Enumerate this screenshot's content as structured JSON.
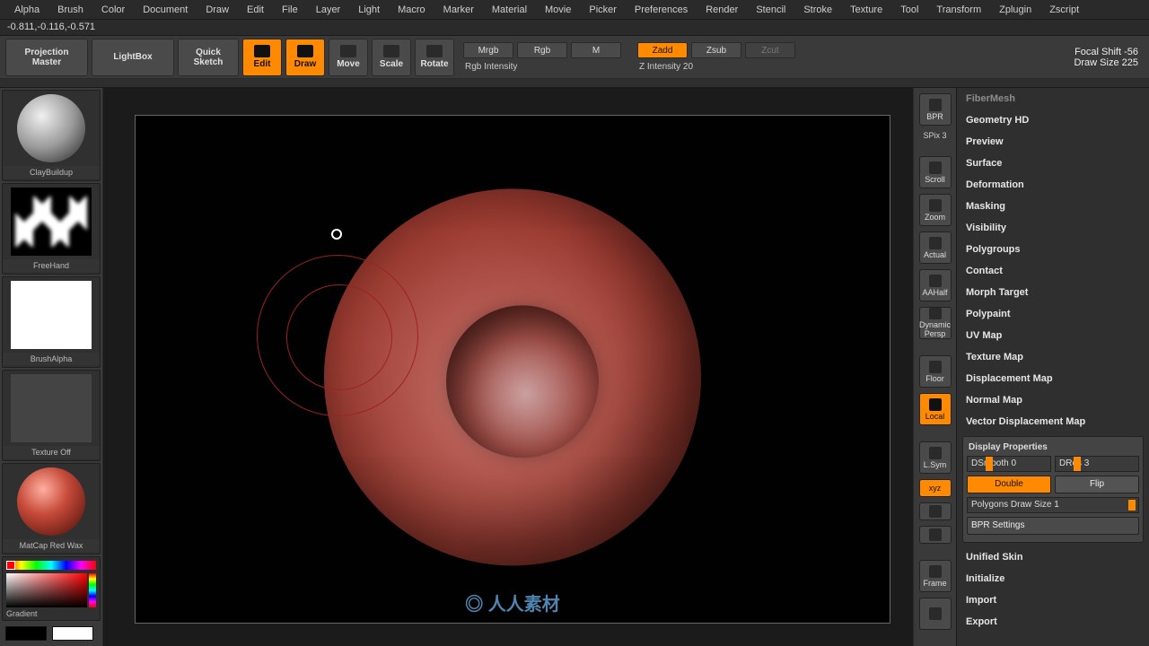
{
  "status": {
    "coords": "-0.811,-0.116,-0.571"
  },
  "menubar": [
    "Alpha",
    "Brush",
    "Color",
    "Document",
    "Draw",
    "Edit",
    "File",
    "Layer",
    "Light",
    "Macro",
    "Marker",
    "Material",
    "Movie",
    "Picker",
    "Preferences",
    "Render",
    "Stencil",
    "Stroke",
    "Texture",
    "Tool",
    "Transform",
    "Zplugin",
    "Zscript"
  ],
  "toolbar": {
    "projection_master": "Projection\nMaster",
    "lightbox": "LightBox",
    "quick_sketch": "Quick\nSketch",
    "edit": "Edit",
    "draw": "Draw",
    "move": "Move",
    "scale": "Scale",
    "rotate": "Rotate",
    "modes": {
      "mrgb": "Mrgb",
      "rgb": "Rgb",
      "m": "M",
      "zadd": "Zadd",
      "zsub": "Zsub",
      "zcut": "Zcut",
      "rgb_intensity": "Rgb Intensity",
      "z_intensity": "Z Intensity 20"
    },
    "focal_shift": "Focal Shift -56",
    "draw_size": "Draw Size 225"
  },
  "left": {
    "brush": "ClayBuildup",
    "stroke": "FreeHand",
    "alpha": "BrushAlpha",
    "texture": "Texture Off",
    "material": "MatCap Red Wax",
    "gradient": "Gradient"
  },
  "rvicons": {
    "bpr": "BPR",
    "spix": "SPix 3",
    "scroll": "Scroll",
    "zoom": "Zoom",
    "actual": "Actual",
    "aahalf": "AAHalf",
    "persp": "Persp",
    "floor": "Floor",
    "local": "Local",
    "xyz": "xyz",
    "lsym": "L.Sym",
    "frame": "Frame",
    "dynamic": "Dynamic"
  },
  "right": {
    "sections_top": [
      "FiberMesh",
      "Geometry HD",
      "Preview",
      "Surface",
      "Deformation",
      "Masking",
      "Visibility",
      "Polygroups",
      "Contact",
      "Morph Target",
      "Polypaint",
      "UV Map",
      "Texture Map",
      "Displacement Map",
      "Normal Map",
      "Vector Displacement Map"
    ],
    "display": {
      "title": "Display Properties",
      "dsmooth_label": "DSmooth 0",
      "dres_label": "DRes 3",
      "double": "Double",
      "flip": "Flip",
      "poly_draw": "Polygons Draw Size 1",
      "bpr": "BPR Settings"
    },
    "sections_bottom": [
      "Unified Skin",
      "Initialize",
      "Import",
      "Export"
    ]
  }
}
